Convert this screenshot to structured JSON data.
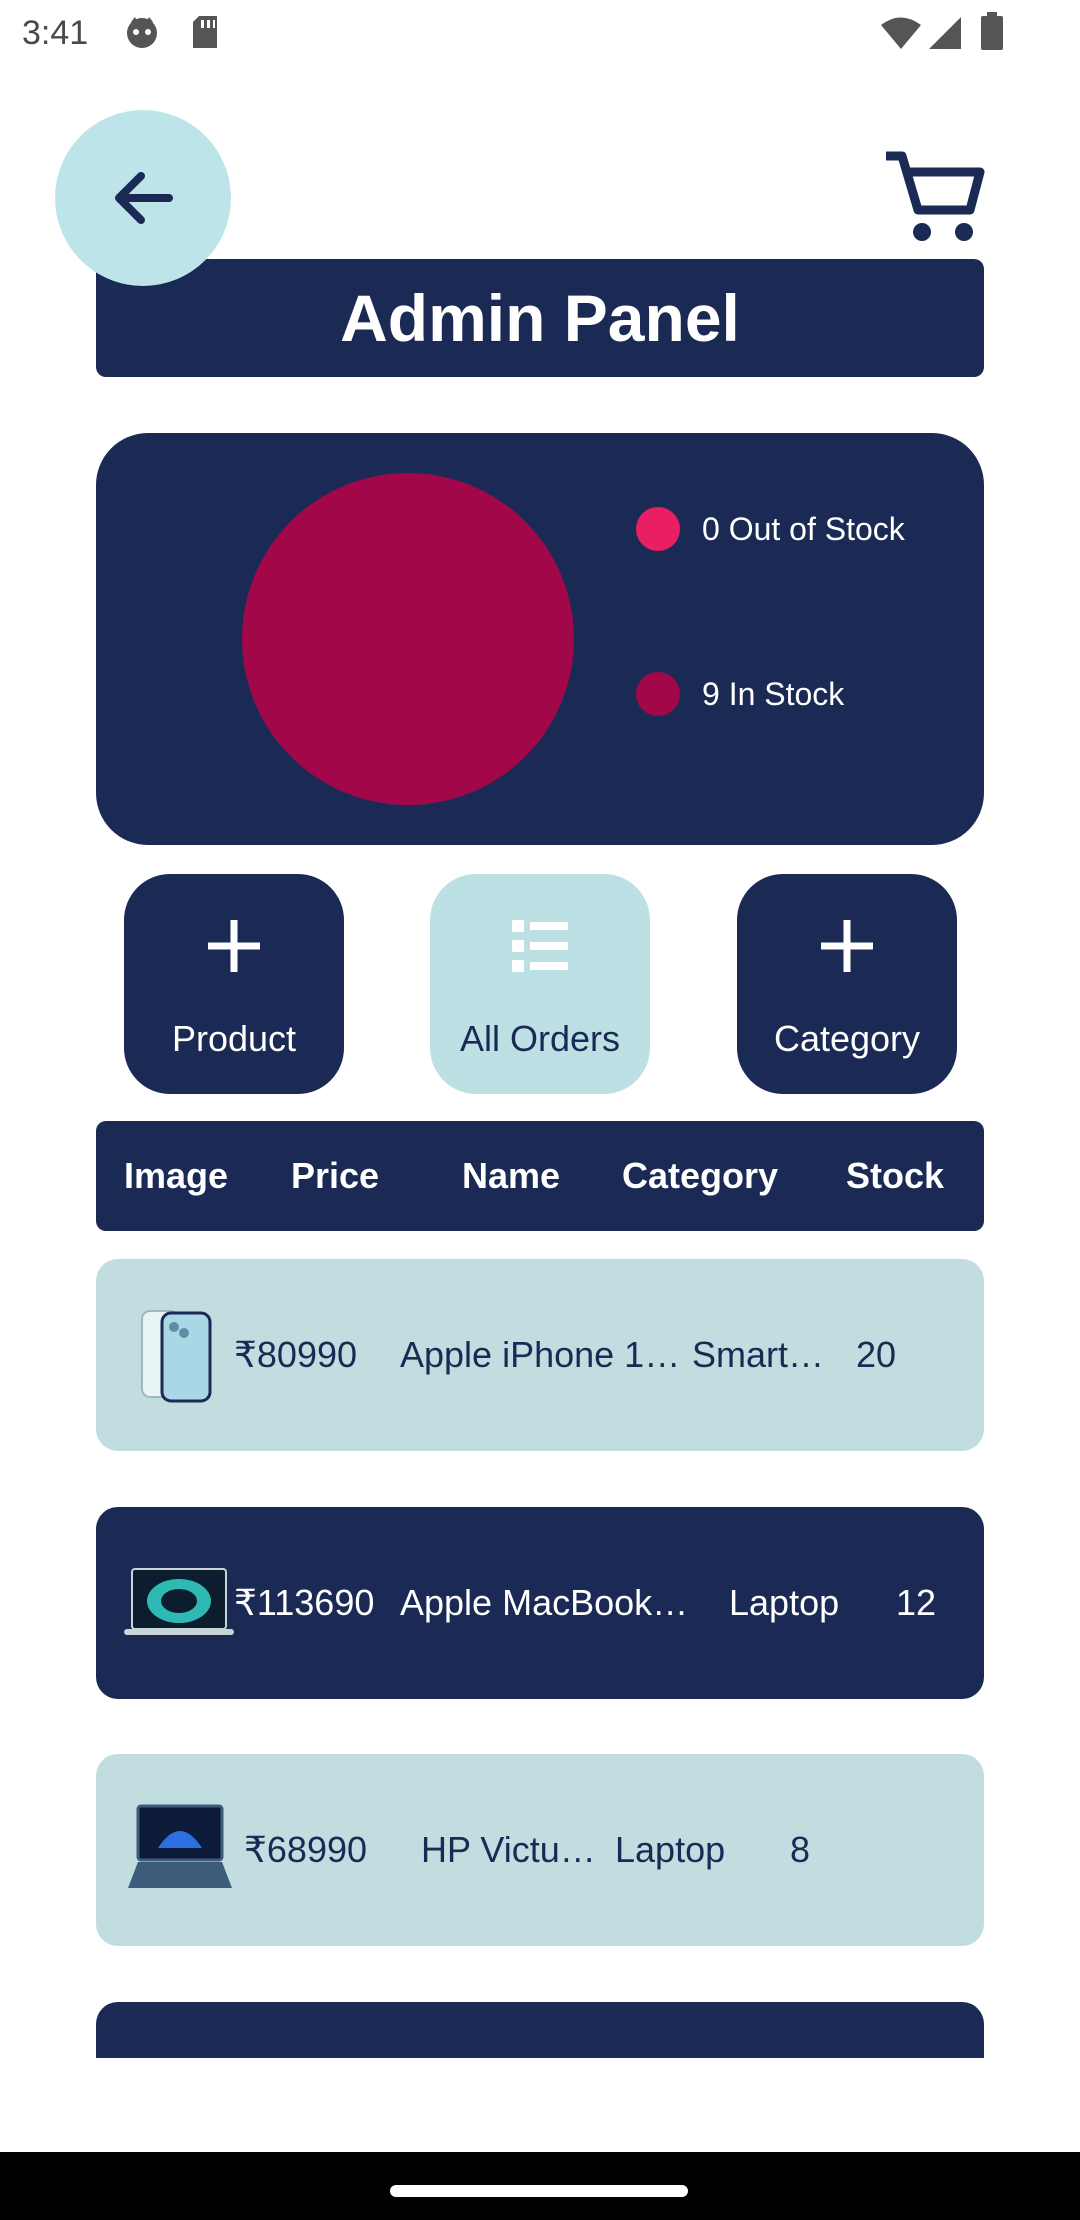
{
  "status_bar": {
    "time": "3:41",
    "left_icons": [
      "face-icon",
      "sd-card-icon"
    ],
    "right_icons": [
      "wifi-icon",
      "signal-icon",
      "battery-icon"
    ]
  },
  "header": {
    "back_icon": "arrow-left-icon",
    "cart_icon": "cart-icon",
    "title": "Admin Panel"
  },
  "stock_chart": {
    "legend": [
      {
        "label": "0 Out of Stock",
        "color": "#e91e63"
      },
      {
        "label": "9 In Stock",
        "color": "#a20749"
      }
    ]
  },
  "chart_data": {
    "type": "pie",
    "categories": [
      "Out of Stock",
      "In Stock"
    ],
    "values": [
      0,
      9
    ],
    "colors": [
      "#e91e63",
      "#a20749"
    ],
    "legend_position": "right"
  },
  "actions": [
    {
      "label": "Product",
      "icon": "plus-icon",
      "style": "dark"
    },
    {
      "label": "All Orders",
      "icon": "list-icon",
      "style": "light"
    },
    {
      "label": "Category",
      "icon": "plus-icon",
      "style": "dark"
    }
  ],
  "table": {
    "headers": [
      "Image",
      "Price",
      "Name",
      "Category",
      "Stock"
    ],
    "rows": [
      {
        "image": "iphone-thumbnail",
        "price": "₹80990",
        "name": "Apple iPhone 1…",
        "category": "Smart…",
        "stock": "20"
      },
      {
        "image": "macbook-thumbnail",
        "price": "₹113690",
        "name": "Apple MacBook…",
        "category": "Laptop",
        "stock": "12"
      },
      {
        "image": "hp-laptop-thumbnail",
        "price": "₹68990",
        "name": "HP Victu…",
        "category": "Laptop",
        "stock": "8"
      }
    ]
  },
  "colors": {
    "primary": "#1b2a55",
    "light": "#c1dde0",
    "accent": "#e91e63",
    "pie": "#a20749"
  }
}
